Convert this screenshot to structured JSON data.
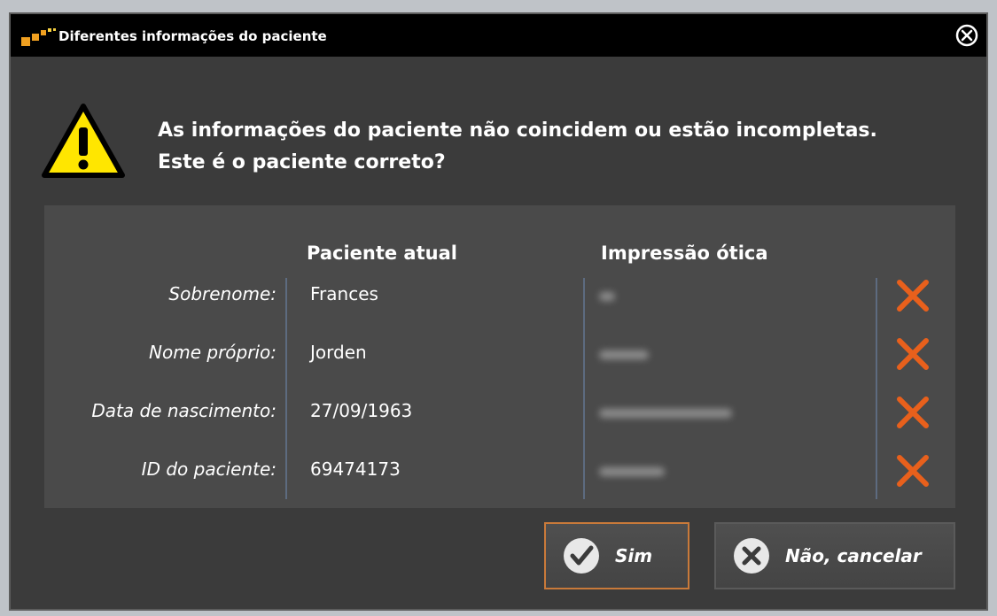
{
  "dialog": {
    "title": "Diferentes informações do paciente",
    "message_line1": "As informações do paciente não coincidem ou estão incompletas.",
    "message_line2": "Este é o paciente correto?"
  },
  "table": {
    "col_current": "Paciente atual",
    "col_optical": "Impressão ótica",
    "rows": [
      {
        "label": "Sobrenome:",
        "value": "Frances"
      },
      {
        "label": "Nome próprio:",
        "value": "Jorden"
      },
      {
        "label": "Data de nascimento:",
        "value": "27/09/1963"
      },
      {
        "label": "ID do paciente:",
        "value": "69474173"
      }
    ]
  },
  "buttons": {
    "yes_label": "Sim",
    "no_label": "Não, cancelar"
  },
  "colors": {
    "mismatch": "#e8601c",
    "warning_fill": "#ffe600",
    "accent_border": "#c97a3a"
  },
  "icons": {
    "app": "app-logo-icon",
    "close": "close-circle-icon",
    "warning": "warning-triangle-icon",
    "mismatch": "x-mark-icon",
    "yes": "check-circle-icon",
    "no": "x-circle-icon"
  }
}
